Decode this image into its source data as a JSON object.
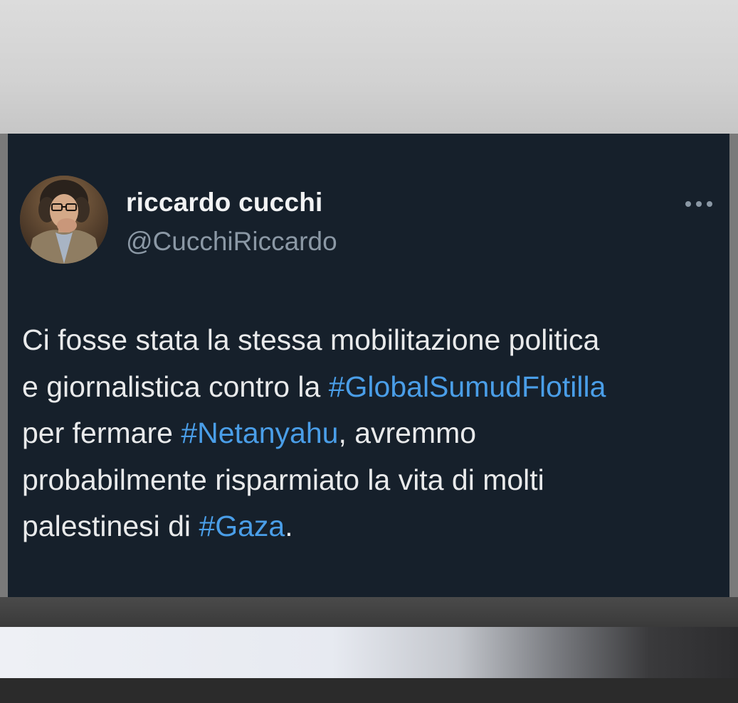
{
  "tweet": {
    "display_name": "riccardo cucchi",
    "handle": "@CucchiRiccardo",
    "more_icon": "more-horizontal-icon",
    "avatar": "profile-photo-man-with-glasses",
    "colors": {
      "background": "#16202b",
      "text": "#e9eaeb",
      "handle": "#8b98a5",
      "hashtag": "#4a9ee8"
    },
    "lines": [
      [
        {
          "text": "Ci fosse stata la stessa mobilitazione politica"
        }
      ],
      [
        {
          "text": "e giornalistica contro la "
        },
        {
          "text": "#GlobalSumudFlotilla",
          "hashtag": true
        }
      ],
      [
        {
          "text": "per fermare "
        },
        {
          "text": "#Netanyahu",
          "hashtag": true
        },
        {
          "text": ", avremmo"
        }
      ],
      [
        {
          "text": "probabilmente risparmiato la vita di molti"
        }
      ],
      [
        {
          "text": "palestinesi di "
        },
        {
          "text": "#Gaza",
          "hashtag": true
        },
        {
          "text": "."
        }
      ]
    ]
  }
}
